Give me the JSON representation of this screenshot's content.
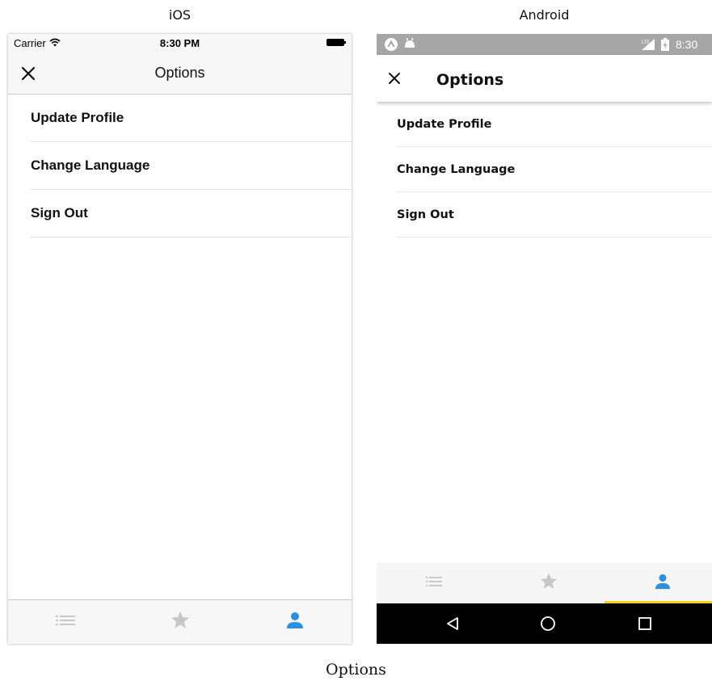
{
  "labels": {
    "ios": "iOS",
    "android": "Android"
  },
  "ios": {
    "status": {
      "carrier": "Carrier",
      "time": "8:30 PM"
    },
    "header": {
      "title": "Options",
      "close_icon": "close-icon"
    },
    "items": [
      {
        "label": "Update Profile"
      },
      {
        "label": "Change Language"
      },
      {
        "label": "Sign Out"
      }
    ],
    "tabs": [
      {
        "icon": "list-icon",
        "active": false
      },
      {
        "icon": "star-icon",
        "active": false
      },
      {
        "icon": "person-icon",
        "active": true
      }
    ]
  },
  "android": {
    "status": {
      "time": "8:30"
    },
    "header": {
      "title": "Options",
      "close_icon": "close-icon"
    },
    "items": [
      {
        "label": "Update Profile"
      },
      {
        "label": "Change Language"
      },
      {
        "label": "Sign Out"
      }
    ],
    "tabs": [
      {
        "icon": "list-icon",
        "active": false
      },
      {
        "icon": "star-icon",
        "active": false
      },
      {
        "icon": "person-icon",
        "active": true
      }
    ],
    "nav": [
      "back-icon",
      "home-icon",
      "recents-icon"
    ]
  },
  "colors": {
    "active_tab": "#2e8fdc",
    "inactive_tab": "#c7c7c7",
    "android_indicator": "#f5d11b",
    "android_status_bar": "#a6a6a6"
  },
  "caption": "Options"
}
